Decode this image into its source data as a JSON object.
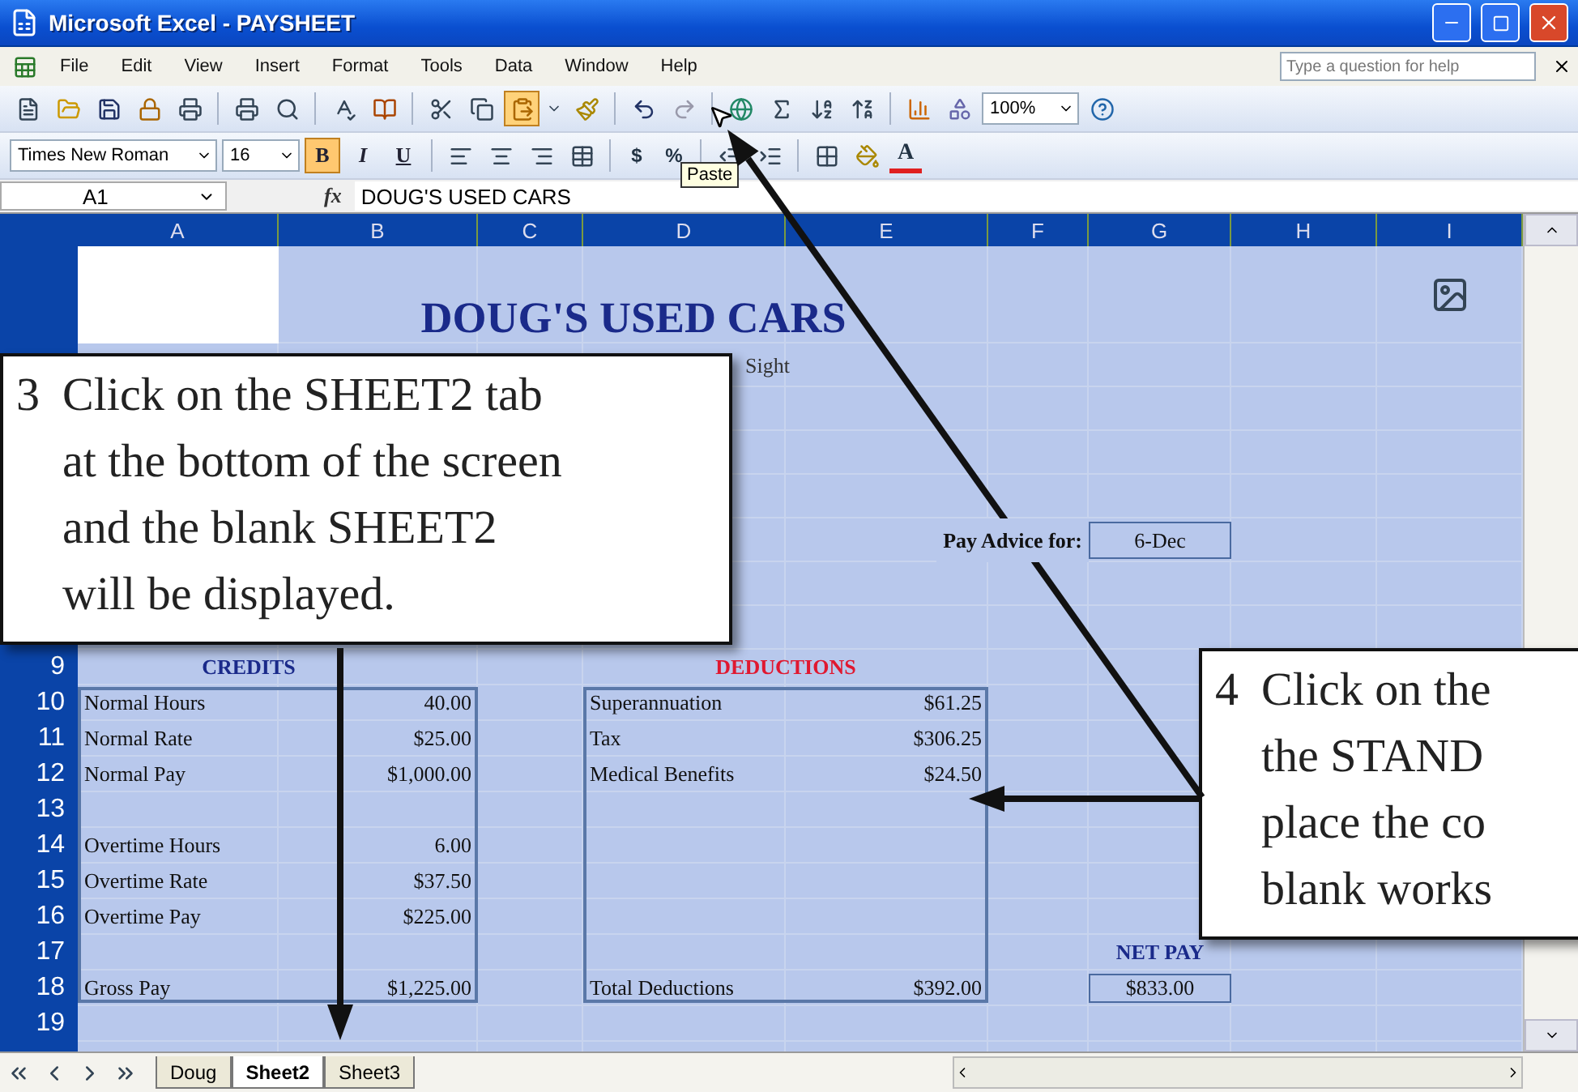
{
  "window": {
    "title": "Microsoft Excel - PAYSHEET"
  },
  "menu": [
    "File",
    "Edit",
    "View",
    "Insert",
    "Format",
    "Tools",
    "Data",
    "Window",
    "Help"
  ],
  "help_box": {
    "placeholder": "Type a question for help"
  },
  "standard_toolbar": {
    "zoom": "100%"
  },
  "tooltip": "Paste",
  "formatting_toolbar": {
    "font": "Times New Roman",
    "size": "16",
    "style_buttons": [
      {
        "label": "B",
        "on": true
      },
      {
        "label": "I",
        "on": false
      },
      {
        "label": "U",
        "on": false
      }
    ],
    "number_buttons": [
      "$",
      "%"
    ],
    "font_color_label": "A"
  },
  "formula_bar": {
    "cell": "A1",
    "function_label": "fx",
    "content": "DOUG'S USED CARS"
  },
  "columns": [
    "A",
    "B",
    "C",
    "D",
    "E",
    "F",
    "G",
    "H",
    "I"
  ],
  "row_numbers": [
    "9",
    "10",
    "11",
    "12",
    "13",
    "14",
    "15",
    "16",
    "17",
    "18",
    "19"
  ],
  "sheet": {
    "title": "DOUG'S USED CARS",
    "subtitle": "Sight",
    "pay_advice": {
      "label": "Pay Advice for:",
      "value": "6-Dec"
    },
    "credits": {
      "heading": "CREDITS",
      "groups": [
        [
          {
            "label": "Normal Hours",
            "value": "40.00"
          },
          {
            "label": "Normal Rate",
            "value": "$25.00"
          },
          {
            "label": "Normal Pay",
            "value": "$1,000.00"
          }
        ],
        [
          {
            "label": "Overtime Hours",
            "value": "6.00"
          },
          {
            "label": "Overtime Rate",
            "value": "$37.50"
          },
          {
            "label": "Overtime Pay",
            "value": "$225.00"
          }
        ]
      ],
      "total": {
        "label": "Gross Pay",
        "value": "$1,225.00"
      }
    },
    "deductions": {
      "heading": "DEDUCTIONS",
      "items": [
        {
          "label": "Superannuation",
          "value": "$61.25"
        },
        {
          "label": "Tax",
          "value": "$306.25"
        },
        {
          "label": "Medical Benefits",
          "value": "$24.50"
        }
      ],
      "total": {
        "label": "Total Deductions",
        "value": "$392.00"
      }
    },
    "net_pay": {
      "label": "NET PAY",
      "value": "$833.00"
    }
  },
  "sheet_tabs": [
    {
      "label": "Doug",
      "selected": false
    },
    {
      "label": "Sheet2",
      "selected": true
    },
    {
      "label": "Sheet3",
      "selected": false
    }
  ],
  "callouts": [
    {
      "step": "3",
      "lines": [
        "Click on the SHEET2 tab",
        "at the bottom of the screen",
        "and the blank SHEET2",
        "will be displayed."
      ]
    },
    {
      "step": "4",
      "lines": [
        "Click on the",
        "the STAND",
        "place the co",
        "blank works"
      ]
    }
  ]
}
